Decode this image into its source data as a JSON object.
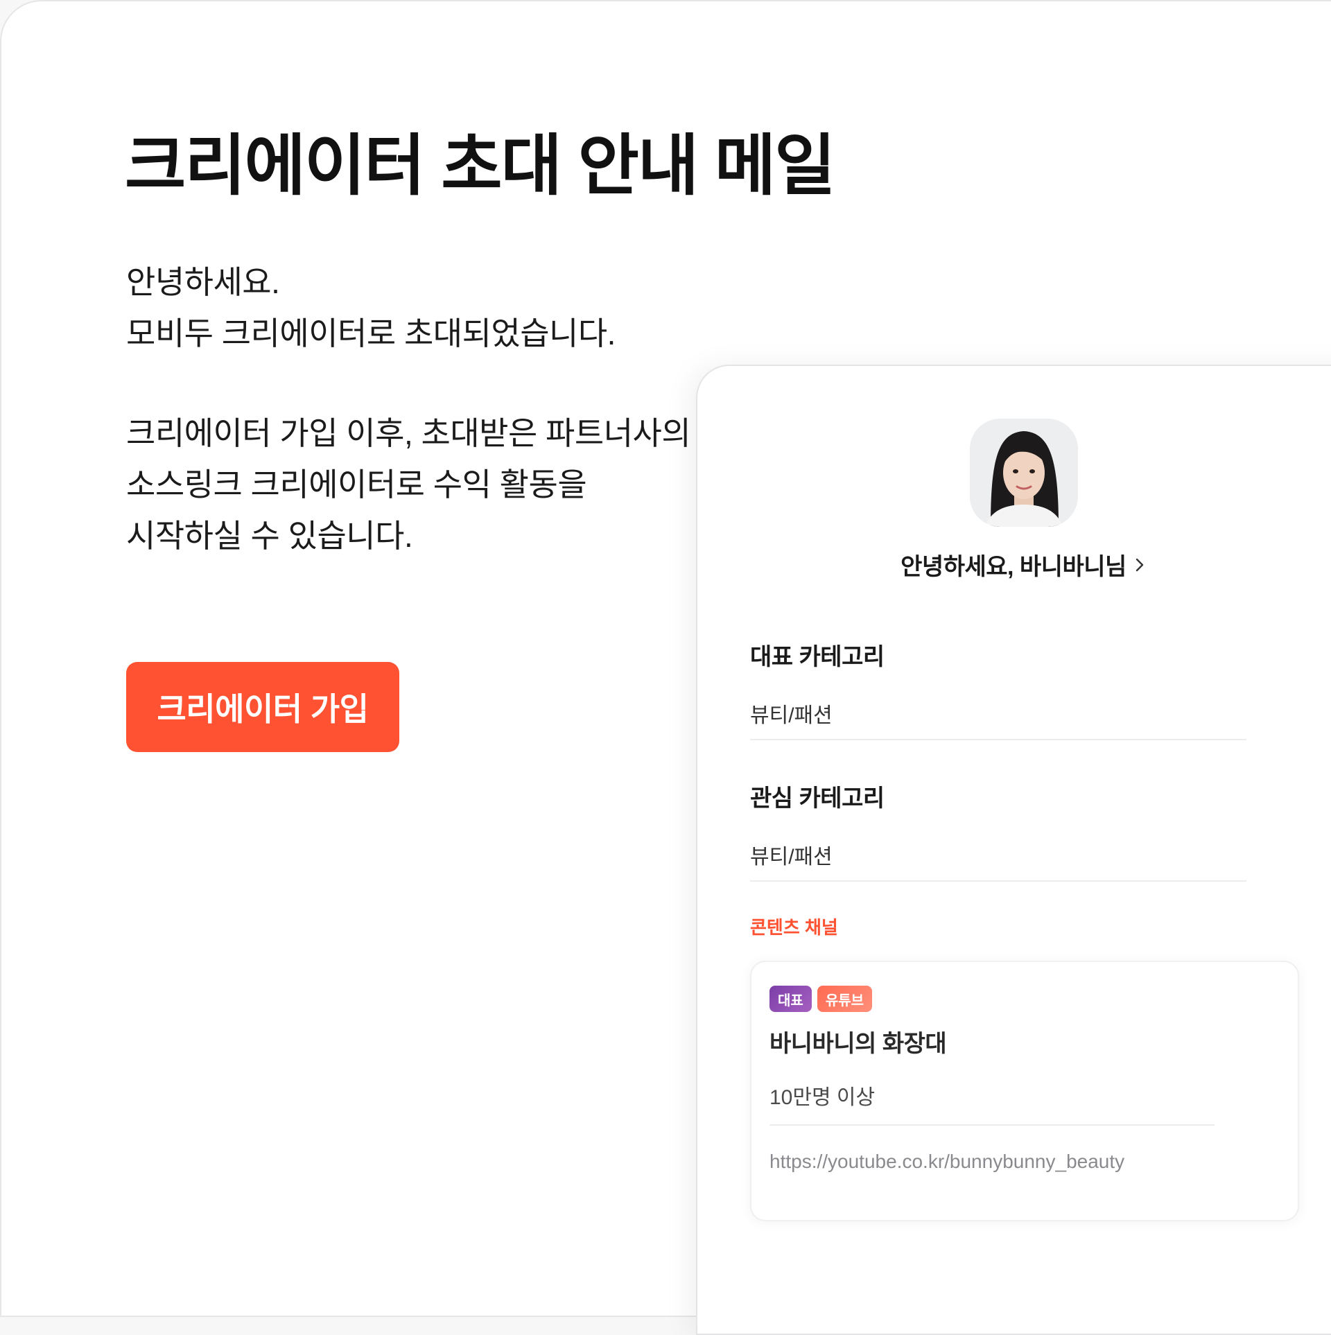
{
  "page": {
    "title": "크리에이터 초대 안내 메일",
    "greeting_lines": [
      "안녕하세요.",
      "모비두 크리에이터로 초대되었습니다."
    ],
    "description_lines": [
      "크리에이터 가입 이후, 초대받은 파트너사의",
      "소스링크 크리에이터로 수익 활동을",
      "시작하실 수 있습니다."
    ],
    "signup_button": "크리에이터 가입"
  },
  "profile": {
    "greeting": "안녕하세요, 바니바니님",
    "main_category_title": "대표 카테고리",
    "main_category_value": "뷰티/패션",
    "interest_category_title": "관심 카테고리",
    "interest_category_value": "뷰티/패션",
    "content_channel_label": "콘텐츠 채널"
  },
  "channel": {
    "badge_main": "대표",
    "badge_platform": "유튜브",
    "name": "바니바니의 화장대",
    "subscribers": "10만명 이상",
    "url": "https://youtube.co.kr/bunnybunny_beauty"
  },
  "colors": {
    "accent": "#ff5232",
    "badge_main": "#8a4cb4",
    "badge_platform": "#ff7a62"
  },
  "icons": {
    "chevron": "chevron-right-icon",
    "avatar": "profile-avatar"
  }
}
